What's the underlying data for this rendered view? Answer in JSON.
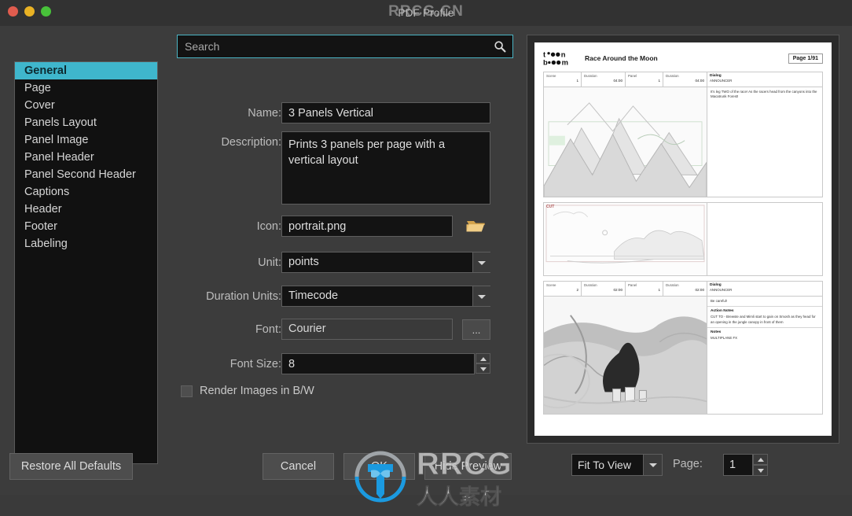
{
  "window": {
    "title": "PDF Profile",
    "traffic_lights": [
      "close",
      "minimize",
      "zoom"
    ],
    "colors": {
      "accent": "#3fb6cc",
      "red": "#e05c4e",
      "yellow": "#e9b224",
      "green": "#48c13a"
    }
  },
  "watermark": {
    "title_overlay": "RRCG.CN",
    "brand": "RRCG",
    "brand_sub": "人人素材"
  },
  "search": {
    "placeholder": "Search",
    "value": "",
    "icon": "search-icon"
  },
  "sidebar": {
    "items": [
      {
        "label": "General",
        "selected": true
      },
      {
        "label": "Page",
        "selected": false
      },
      {
        "label": "Cover",
        "selected": false
      },
      {
        "label": "Panels Layout",
        "selected": false
      },
      {
        "label": "Panel Image",
        "selected": false
      },
      {
        "label": "Panel Header",
        "selected": false
      },
      {
        "label": "Panel Second Header",
        "selected": false
      },
      {
        "label": "Captions",
        "selected": false
      },
      {
        "label": "Header",
        "selected": false
      },
      {
        "label": "Footer",
        "selected": false
      },
      {
        "label": "Labeling",
        "selected": false
      }
    ]
  },
  "form": {
    "name": {
      "label": "Name:",
      "value": "3 Panels Vertical"
    },
    "description": {
      "label": "Description:",
      "value": "Prints 3 panels per page with a vertical layout"
    },
    "icon": {
      "label": "Icon:",
      "value": "portrait.png",
      "browse_icon": "folder-icon"
    },
    "unit": {
      "label": "Unit:",
      "value": "points"
    },
    "duration_units": {
      "label": "Duration Units:",
      "value": "Timecode"
    },
    "font": {
      "label": "Font:",
      "value": "Courier",
      "browse_label": "..."
    },
    "font_size": {
      "label": "Font Size:",
      "value": "8"
    },
    "render_bw": {
      "label": "Render Images in B/W",
      "checked": false
    }
  },
  "buttons": {
    "restore": "Restore All Defaults",
    "cancel": "Cancel",
    "ok": "OK",
    "hide_preview": "Hide Preview"
  },
  "preview_controls": {
    "zoom_mode": "Fit To View",
    "page_label": "Page:",
    "page_value": "1"
  },
  "document": {
    "title": "Race Around the Moon",
    "logo": "toon-boom-logo",
    "page_indicator": "Page  1/91",
    "columns": [
      "Scene",
      "Duration",
      "Panel",
      "Duration",
      "Dialog"
    ],
    "panels": [
      {
        "scene": "1",
        "scene_duration": "04:00",
        "panel": "1",
        "panel_duration": "04:00",
        "cut_tag": "",
        "notes": [
          {
            "heading": "Dialog",
            "speaker": "ANNOUNCER",
            "text": "It's leg TWO of the race! As the racers head from the canyons into the Macatrunk Forest!"
          }
        ]
      },
      {
        "scene": "",
        "scene_duration": "",
        "panel": "",
        "panel_duration": "",
        "cut_tag": "CUT",
        "notes": []
      },
      {
        "scene": "2",
        "scene_duration": "02:00",
        "panel": "1",
        "panel_duration": "02:00",
        "cut_tag": "",
        "notes": [
          {
            "heading": "Dialog",
            "speaker": "ANNOUNCER",
            "text": "Be careful!"
          },
          {
            "heading": "Action Notes",
            "speaker": "",
            "text": "CUT TO - Brewste and Mimli start to gain on Smosh as they head for an opening in the jungle canopy in front of them"
          },
          {
            "heading": "Notes",
            "speaker": "",
            "text": "MULTIPLANE FX"
          }
        ]
      }
    ]
  }
}
